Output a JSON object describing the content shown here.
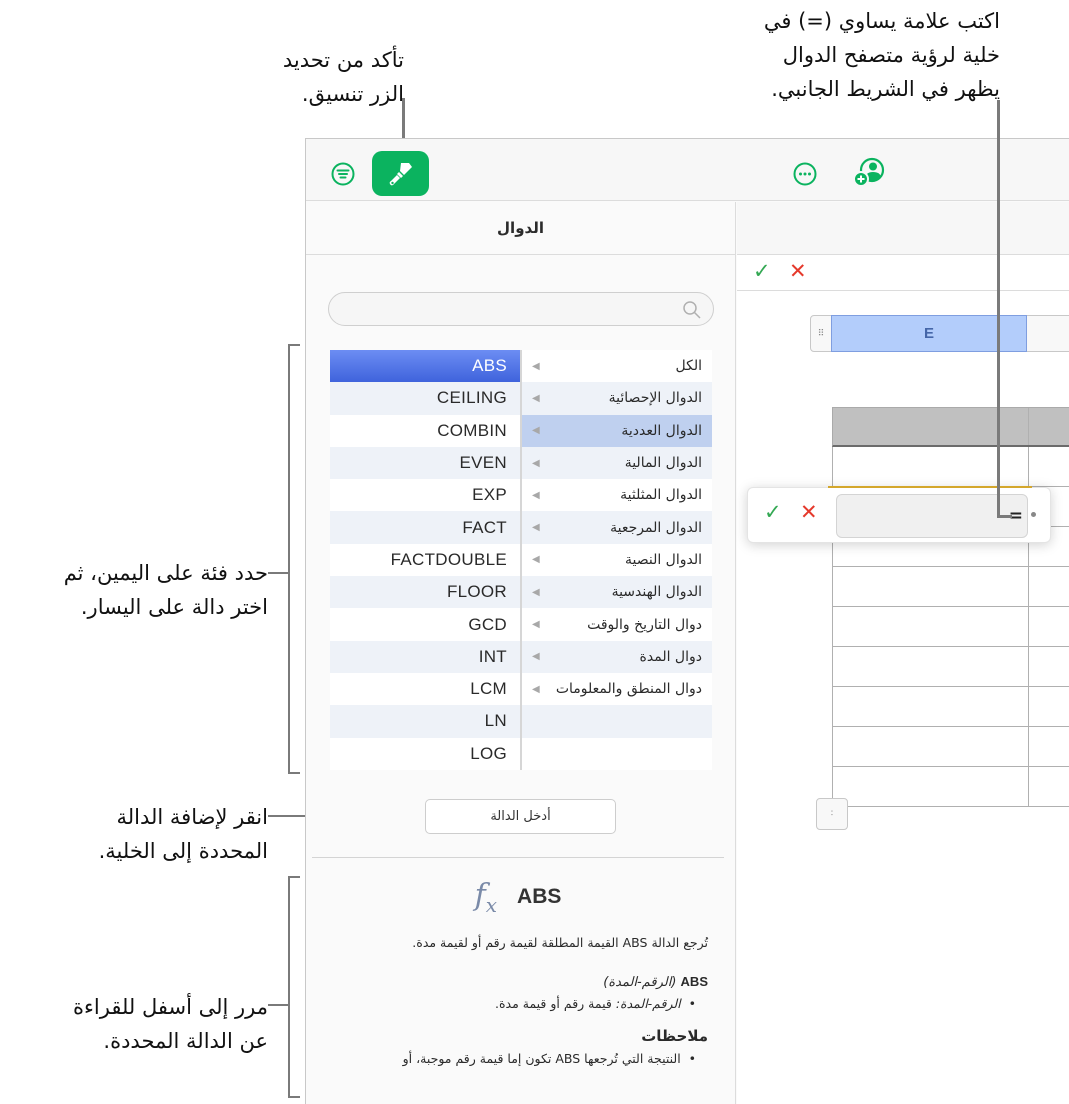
{
  "callouts": {
    "format_button": [
      "تأكد من تحديد",
      "الزر تنسيق."
    ],
    "equals_sign": [
      "اكتب علامة يساوي (=) في",
      "خلية لرؤية متصفح الدوال",
      "يظهر في الشريط الجانبي."
    ],
    "select_category": [
      "حدد فئة على اليمين، ثم",
      "اختر دالة على اليسار."
    ],
    "insert_function": [
      "انقر لإضافة الدالة",
      "المحددة إلى الخلية."
    ],
    "scroll_down": [
      "مرر إلى أسفل للقراءة",
      "عن الدالة المحددة."
    ]
  },
  "toolbar": {
    "organize_icon": "organize-icon",
    "format_icon": "paintbrush-icon",
    "more_icon": "ellipsis-circle-icon",
    "collaborate_icon": "add-person-icon",
    "accent_color": "#0BB35F"
  },
  "sidebar": {
    "title": "الدوال",
    "search": {
      "value": "",
      "placeholder": ""
    },
    "categories": [
      "الكل",
      "الدوال الإحصائية",
      "الدوال العددية",
      "الدوال المالية",
      "الدوال المثلثية",
      "الدوال المرجعية",
      "الدوال النصية",
      "الدوال الهندسية",
      "دوال التاريخ والوقت",
      "دوال المدة",
      "دوال المنطق والمعلومات",
      "",
      ""
    ],
    "selected_category_index": 2,
    "functions": [
      "ABS",
      "CEILING",
      "COMBIN",
      "EVEN",
      "EXP",
      "FACT",
      "FACTDOUBLE",
      "FLOOR",
      "GCD",
      "INT",
      "LCM",
      "LN",
      "LOG"
    ],
    "selected_function_index": 0,
    "insert_button": "أدخل الدالة",
    "doc": {
      "function_name": "ABS",
      "fx_symbol": "fx",
      "description": "تُرجع الدالة ABS القيمة المطلقة لقيمة رقم أو لقيمة مدة.",
      "syntax_name": "ABS",
      "syntax_args": "(الرقم-المدة)",
      "arg_name": "الرقم-المدة:",
      "arg_desc": "قيمة رقم أو قيمة مدة.",
      "notes_heading": "ملاحظات",
      "note_1": "النتيجة التي تُرجعها ABS تكون إما قيمة رقم موجبة، أو"
    }
  },
  "canvas": {
    "formula_accept": "✓",
    "formula_cancel": "✕",
    "column_label": "E",
    "cell_editor": {
      "accept": "✓",
      "cancel": "✕",
      "value": "="
    }
  }
}
